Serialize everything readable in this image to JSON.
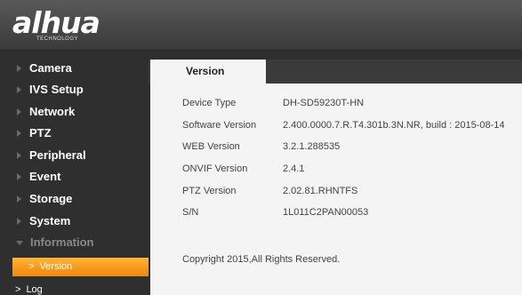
{
  "logo": {
    "main": "alhua",
    "sub": "TECHNOLOGY"
  },
  "sidebar": {
    "items": [
      {
        "label": "Camera"
      },
      {
        "label": "IVS Setup"
      },
      {
        "label": "Network"
      },
      {
        "label": "PTZ"
      },
      {
        "label": "Peripheral"
      },
      {
        "label": "Event"
      },
      {
        "label": "Storage"
      },
      {
        "label": "System"
      },
      {
        "label": "Information",
        "expanded": true
      }
    ],
    "sub_items": [
      {
        "label": "Version",
        "active": true
      },
      {
        "label": "Log",
        "active": false
      }
    ]
  },
  "main": {
    "tab_label": "Version",
    "rows": [
      {
        "key": "Device Type",
        "value": "DH-SD59230T-HN"
      },
      {
        "key": "Software Version",
        "value": "2.400.0000.7.R.T4.301b.3N.NR, build : 2015-08-14"
      },
      {
        "key": "WEB Version",
        "value": "3.2.1.288535"
      },
      {
        "key": "ONVIF Version",
        "value": "2.4.1"
      },
      {
        "key": "PTZ Version",
        "value": "2.02.81.RHNTFS"
      },
      {
        "key": "S/N",
        "value": "1L011C2PAN00053"
      }
    ],
    "copyright": "Copyright 2015,All Rights Reserved."
  },
  "colors": {
    "accent": "#f8991a",
    "sidebar_bg": "#2f2f2f",
    "content_bg": "#f4f4f4"
  }
}
